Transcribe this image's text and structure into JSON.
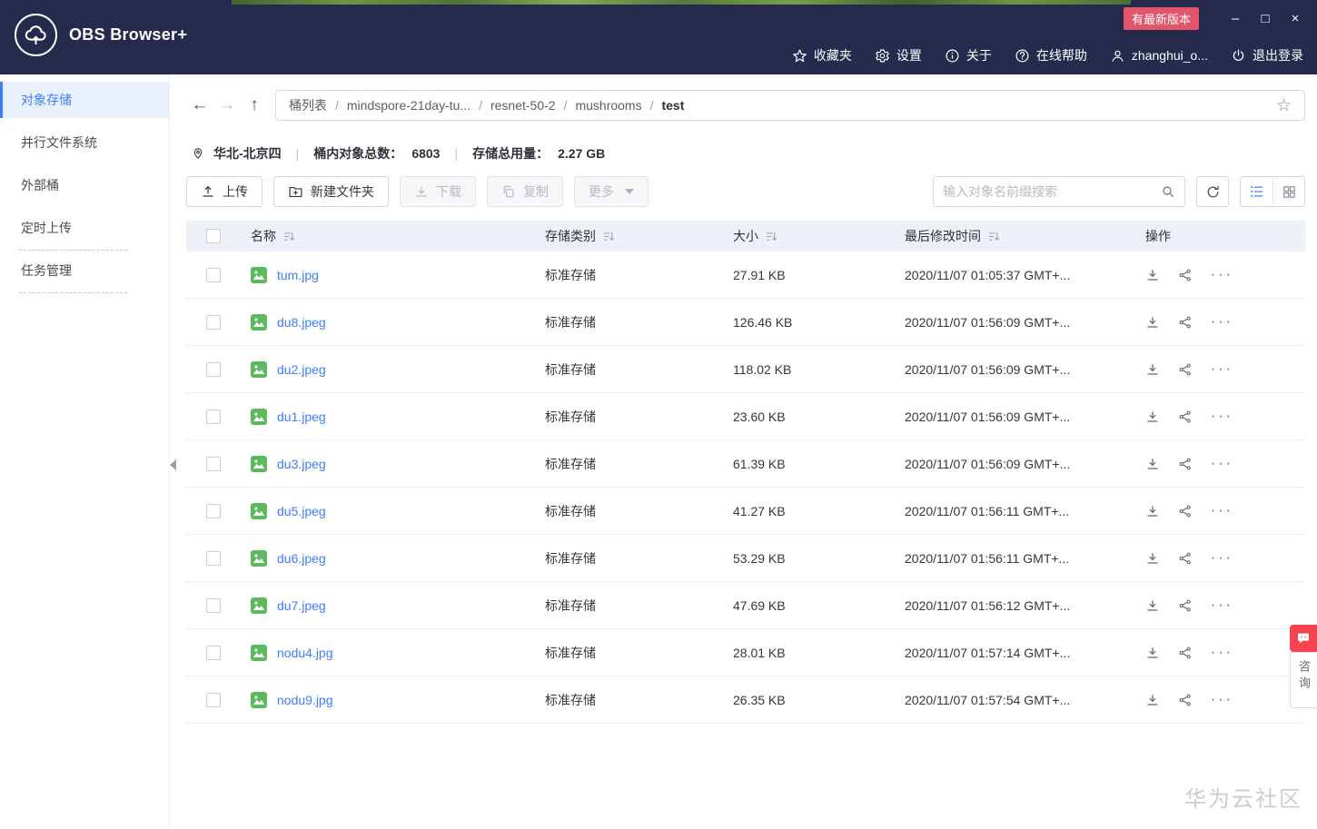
{
  "window": {
    "app_title": "OBS Browser+",
    "update_badge": "有最新版本",
    "controls": {
      "minimize": "–",
      "maximize": "□",
      "close": "×"
    }
  },
  "topnav": {
    "items": [
      {
        "label": "收藏夹"
      },
      {
        "label": "设置"
      },
      {
        "label": "关于"
      },
      {
        "label": "在线帮助"
      },
      {
        "label": "zhanghui_o..."
      },
      {
        "label": "退出登录"
      }
    ]
  },
  "sidebar": {
    "items": [
      {
        "label": "对象存储",
        "active": true
      },
      {
        "label": "并行文件系统",
        "active": false
      },
      {
        "label": "外部桶",
        "active": false
      },
      {
        "label": "定时上传",
        "active": false
      },
      {
        "label": "任务管理",
        "active": false
      }
    ]
  },
  "breadcrumb": {
    "separator": "/",
    "segments": [
      "桶列表",
      "mindspore-21day-tu...",
      "resnet-50-2",
      "mushrooms",
      "test"
    ]
  },
  "bucket_info": {
    "region": "华北-北京四",
    "divider": "|",
    "object_count_label": "桶内对象总数：",
    "object_count": "6803",
    "usage_label": "存储总用量：",
    "usage": "2.27 GB"
  },
  "toolbar": {
    "upload_label": "上传",
    "new_folder_label": "新建文件夹",
    "download_label": "下载",
    "copy_label": "复制",
    "more_label": "更多",
    "search_placeholder": "输入对象名前缀搜索"
  },
  "table": {
    "columns": [
      {
        "label": "名称"
      },
      {
        "label": "存储类别"
      },
      {
        "label": "大小"
      },
      {
        "label": "最后修改时间"
      },
      {
        "label": "操作"
      }
    ],
    "rows": [
      {
        "name": "tum.jpg",
        "storage_class": "标准存储",
        "size": "27.91 KB",
        "modified": "2020/11/07 01:05:37 GMT+..."
      },
      {
        "name": "du8.jpeg",
        "storage_class": "标准存储",
        "size": "126.46 KB",
        "modified": "2020/11/07 01:56:09 GMT+..."
      },
      {
        "name": "du2.jpeg",
        "storage_class": "标准存储",
        "size": "118.02 KB",
        "modified": "2020/11/07 01:56:09 GMT+..."
      },
      {
        "name": "du1.jpeg",
        "storage_class": "标准存储",
        "size": "23.60 KB",
        "modified": "2020/11/07 01:56:09 GMT+..."
      },
      {
        "name": "du3.jpeg",
        "storage_class": "标准存储",
        "size": "61.39 KB",
        "modified": "2020/11/07 01:56:09 GMT+..."
      },
      {
        "name": "du5.jpeg",
        "storage_class": "标准存储",
        "size": "41.27 KB",
        "modified": "2020/11/07 01:56:11 GMT+..."
      },
      {
        "name": "du6.jpeg",
        "storage_class": "标准存储",
        "size": "53.29 KB",
        "modified": "2020/11/07 01:56:11 GMT+..."
      },
      {
        "name": "du7.jpeg",
        "storage_class": "标准存储",
        "size": "47.69 KB",
        "modified": "2020/11/07 01:56:12 GMT+..."
      },
      {
        "name": "nodu4.jpg",
        "storage_class": "标准存储",
        "size": "28.01 KB",
        "modified": "2020/11/07 01:57:14 GMT+..."
      },
      {
        "name": "nodu9.jpg",
        "storage_class": "标准存储",
        "size": "26.35 KB",
        "modified": "2020/11/07 01:57:54 GMT+..."
      }
    ]
  },
  "icons": {
    "back": "←",
    "forward": "→",
    "up": "↑",
    "favorite_star": "☆",
    "more_ellipsis": "···"
  },
  "chat_widget": {
    "label": "咨询"
  },
  "watermark": "华为云社区",
  "colors": {
    "header_bg": "#262b4d",
    "accent_blue": "#3d7ef9",
    "badge_red": "#e2566b",
    "file_icon_green": "#5dba5c",
    "chat_red": "#f5434f",
    "table_header_bg": "#eef0f7"
  }
}
